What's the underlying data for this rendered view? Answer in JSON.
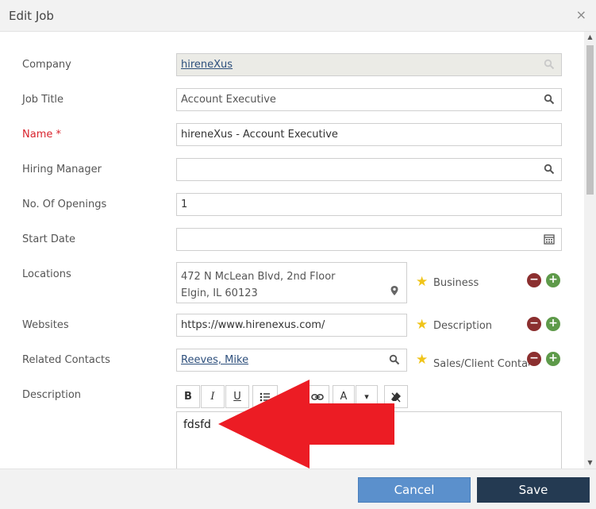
{
  "dialog": {
    "title": "Edit Job",
    "close_glyph": "×"
  },
  "form": {
    "company": {
      "label": "Company",
      "value": "hireneXus"
    },
    "job_title": {
      "label": "Job Title",
      "value": "Account Executive"
    },
    "name": {
      "label": "Name",
      "required_mark": " *",
      "value": "hireneXus - Account Executive"
    },
    "hiring_manager": {
      "label": "Hiring Manager",
      "value": ""
    },
    "openings": {
      "label": "No. Of Openings",
      "value": "1"
    },
    "start_date": {
      "label": "Start Date",
      "value": ""
    },
    "locations": {
      "label": "Locations",
      "line1": "472 N McLean Blvd, 2nd Floor",
      "line2": "Elgin, IL 60123",
      "type": "Business"
    },
    "websites": {
      "label": "Websites",
      "value": "https://www.hirenexus.com/",
      "type": "Description"
    },
    "related_contacts": {
      "label": "Related Contacts",
      "value": "Reeves, Mike",
      "type": "Sales/Client Contact"
    },
    "description": {
      "label": "Description",
      "text": "fdsfd",
      "toolbar": {
        "bold": "B",
        "italic": "I",
        "underline": "U",
        "font_color": "A",
        "dropdown": "▾"
      }
    }
  },
  "footer": {
    "cancel_label": "Cancel",
    "save_label": "Save"
  },
  "colors": {
    "required": "#d9232d",
    "star": "#f0c419",
    "minus": "#8b2f2f",
    "plus": "#5e9a4a",
    "cancel_bg": "#5b90cc",
    "save_bg": "#243a52",
    "arrow": "#ec1c24"
  }
}
